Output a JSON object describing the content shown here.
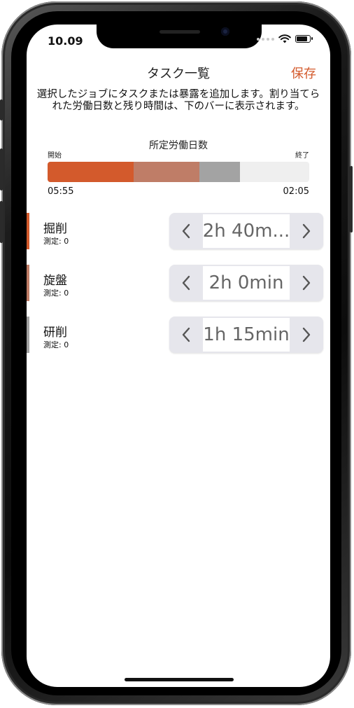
{
  "status_bar": {
    "time": "10.09"
  },
  "nav": {
    "title": "タスク一覧",
    "save_label": "保存"
  },
  "description": "選択したジョブにタスクまたは暴露を追加します。割り当てられた労働日数と残り時間は、下のバーに表示されます。",
  "workday": {
    "label": "所定労働日数",
    "start_label": "開始",
    "end_label": "終了",
    "start_time": "05:55",
    "end_time": "02:05",
    "segments": [
      {
        "fraction": 0.33,
        "color": "#d35a2c"
      },
      {
        "fraction": 0.25,
        "color": "#bf7d67"
      },
      {
        "fraction": 0.155,
        "color": "#a3a3a3"
      }
    ],
    "track_color": "#efefef"
  },
  "tasks": [
    {
      "name": "掘削",
      "meta": "測定: 0",
      "duration": "2h 40m...",
      "accent_color": "#d35a2c"
    },
    {
      "name": "旋盤",
      "meta": "測定: 0",
      "duration": "2h 0min",
      "accent_color": "#bf7d67"
    },
    {
      "name": "研削",
      "meta": "測定: 0",
      "duration": "1h 15min",
      "accent_color": "#a3a3a3"
    }
  ],
  "icons": {
    "decrement": "chevron-left-icon",
    "increment": "chevron-right-icon",
    "signal": "signal-dots-icon",
    "wifi": "wifi-icon",
    "battery": "battery-icon"
  },
  "colors": {
    "accent": "#d35a2c"
  }
}
